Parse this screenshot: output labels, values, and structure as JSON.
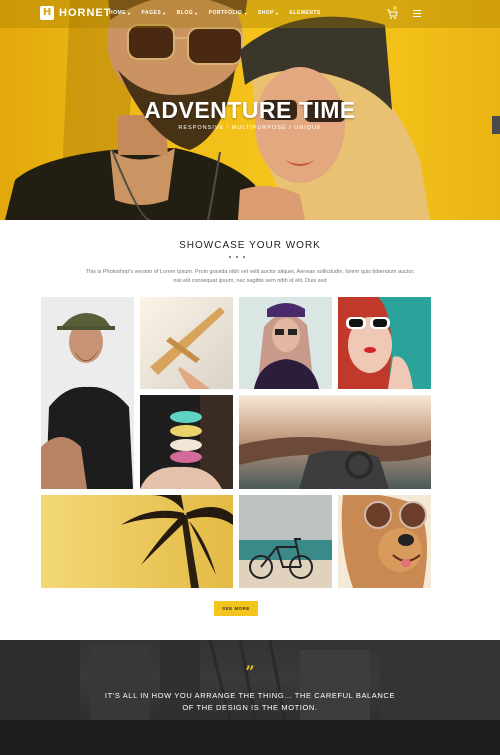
{
  "brand": {
    "name": "HORNET",
    "mark": "H"
  },
  "nav": {
    "items": [
      {
        "label": "HOME",
        "dropdown": true
      },
      {
        "label": "PAGES",
        "dropdown": true
      },
      {
        "label": "BLOG",
        "dropdown": true
      },
      {
        "label": "PORTFOLIO",
        "dropdown": true
      },
      {
        "label": "SHOP",
        "dropdown": true
      },
      {
        "label": "ELEMENTS",
        "dropdown": false
      }
    ],
    "icons": [
      "cart-icon",
      "hamburger-menu-icon"
    ]
  },
  "hero": {
    "title": "ADVENTURE TIME",
    "subtitle": "RESPONSIVE / MULTIPURPOSE / UNIQUE"
  },
  "showcase": {
    "title": "SHOWCASE YOUR WORK",
    "intro_line1": "This is Photoshop's version of Lorem Ipsum. Proin gravida nibh vel velit auctor aliquet. Aenean sollicitudin, lorem quis bibendum auctor,",
    "intro_line2": "nisi elit consequat ipsum, nec sagittis sem nibh id elit. Duis sed",
    "see_more_label": "SEE MORE"
  },
  "gallery": [
    "portrait-man-hat",
    "toy-airplane",
    "woman-sunglasses",
    "red-hair-woman",
    "macarons",
    "motorcycle-handlebars",
    "palm-tree",
    "bicycle-beach",
    "dog-sunglasses"
  ],
  "quote": {
    "mark": "”",
    "line1": "IT'S ALL IN HOW YOU ARRANGE THE THING... THE CAREFUL BALANCE",
    "line2": "OF THE DESIGN IS THE MOTION."
  },
  "colors": {
    "accent": "#f3c51d",
    "dark": "#333333",
    "footer": "#1e1e1e"
  }
}
